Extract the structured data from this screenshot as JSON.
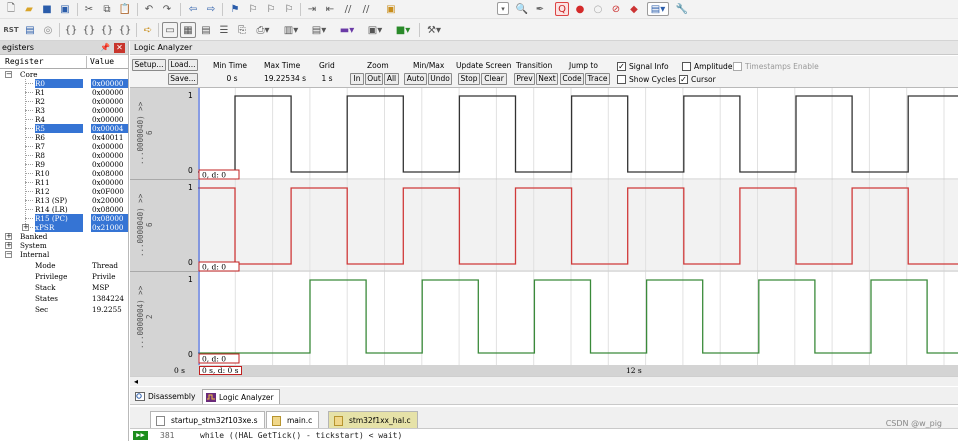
{
  "registers_panel": {
    "title": "egisters",
    "pin_icon": "pin-icon",
    "col_register": "Register",
    "col_value": "Value",
    "core_label": "Core",
    "core_rows": [
      {
        "name": "R0",
        "value": "0x00000",
        "highlight": true
      },
      {
        "name": "R1",
        "value": "0x00000",
        "highlight": false
      },
      {
        "name": "R2",
        "value": "0x00000",
        "highlight": false
      },
      {
        "name": "R3",
        "value": "0x00000",
        "highlight": false
      },
      {
        "name": "R4",
        "value": "0x00000",
        "highlight": false
      },
      {
        "name": "R5",
        "value": "0x00004",
        "highlight": true
      },
      {
        "name": "R6",
        "value": "0x40011",
        "highlight": false
      },
      {
        "name": "R7",
        "value": "0x00000",
        "highlight": false
      },
      {
        "name": "R8",
        "value": "0x00000",
        "highlight": false
      },
      {
        "name": "R9",
        "value": "0x00000",
        "highlight": false
      },
      {
        "name": "R10",
        "value": "0x08000",
        "highlight": false
      },
      {
        "name": "R11",
        "value": "0x00000",
        "highlight": false
      },
      {
        "name": "R12",
        "value": "0x0F000",
        "highlight": false
      },
      {
        "name": "R13 (SP)",
        "value": "0x20000",
        "highlight": false
      },
      {
        "name": "R14 (LR)",
        "value": "0x08000",
        "highlight": false
      },
      {
        "name": "R15 (PC)",
        "value": "0x08000",
        "highlight": true
      },
      {
        "name": "xPSR",
        "value": "0x21000",
        "highlight": true
      }
    ],
    "groups": [
      "Banked",
      "System",
      "Internal"
    ],
    "internal_rows": [
      {
        "name": "Mode",
        "value": "Thread"
      },
      {
        "name": "Privilege",
        "value": "Privile"
      },
      {
        "name": "Stack",
        "value": "MSP"
      },
      {
        "name": "States",
        "value": "1384224"
      },
      {
        "name": "Sec",
        "value": "19.2255"
      }
    ]
  },
  "logic_analyzer": {
    "title": "Logic Analyzer",
    "setup_label": "Setup...",
    "load_label": "Load...",
    "save_label": "Save...",
    "min_time_label": "Min Time",
    "min_time_value": "0 s",
    "max_time_label": "Max Time",
    "max_time_value": "19.22534 s",
    "grid_label": "Grid",
    "grid_value": "1 s",
    "zoom_label": "Zoom",
    "zoom_in": "In",
    "zoom_out": "Out",
    "zoom_all": "All",
    "minmax_label": "Min/Max",
    "minmax_auto": "Auto",
    "minmax_undo": "Undo",
    "update_label": "Update Screen",
    "update_stop": "Stop",
    "update_clear": "Clear",
    "transition_label": "Transition",
    "transition_prev": "Prev",
    "transition_next": "Next",
    "jump_label": "Jump to",
    "jump_code": "Code",
    "jump_trace": "Trace",
    "signal_info_label": "Signal Info",
    "signal_info_checked": true,
    "show_cycles_label": "Show Cycles",
    "show_cycles_checked": false,
    "amplitude_label": "Amplitude",
    "amplitude_checked": false,
    "cursor_label": "Cursor",
    "cursor_checked": true,
    "timestamps_label": "Timestamps Enable",
    "timestamps_checked": false,
    "signals": [
      {
        "name": "...0000040) >> 6",
        "high": "1",
        "low": "0",
        "color": "#333333",
        "cursor_text": "0,  d: 0"
      },
      {
        "name": "...0000040) >> 6",
        "high": "1",
        "low": "0",
        "color": "#d03a3a",
        "cursor_text": "0,  d: 0"
      },
      {
        "name": "...0000004) >> 2",
        "high": "1",
        "low": "0",
        "color": "#3a8a3a",
        "cursor_text": "0,  d: 0"
      }
    ],
    "time_axis_left": "0 s",
    "time_axis_cursor": "0 s,  d: 0 s",
    "time_axis_mid": "12 s"
  },
  "tabs": [
    {
      "label": "Disassembly",
      "active": false,
      "icon": "disassembly-icon"
    },
    {
      "label": "Logic Analyzer",
      "active": true,
      "icon": "logic-analyzer-icon"
    }
  ],
  "file_tabs": [
    {
      "label": "startup_stm32f103xe.s",
      "highlight": false
    },
    {
      "label": "main.c",
      "highlight": false
    },
    {
      "label": "stm32f1xx_hal.c",
      "highlight": true
    }
  ],
  "code_line": {
    "arrow": "▶▶",
    "number": "381",
    "text": "while ((HAL GetTick() - tickstart) < wait)"
  },
  "watermark": "CSDN @w_pig"
}
